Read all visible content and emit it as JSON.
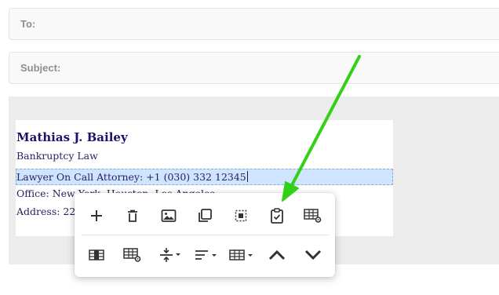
{
  "form": {
    "to_label": "To:",
    "subject_label": "Subject:"
  },
  "signature": {
    "name": "Mathias J. Bailey",
    "title": "Bankruptcy Law",
    "phone_line": "Lawyer On Call Attorney: +1 (030) 332 12345",
    "office_line": "Office: New York, Houston, Los Angeles",
    "address_line": "Address: 22"
  },
  "toolbar": {
    "row1": [
      "add-icon",
      "delete-icon",
      "image-icon",
      "duplicate-icon",
      "select-all-icon",
      "paste-icon",
      "table-settings-icon"
    ],
    "row2": [
      "columns-icon",
      "cell-settings-icon",
      "vertical-spacing-icon",
      "align-icon",
      "table-layout-icon",
      "move-up-icon",
      "move-down-icon"
    ]
  },
  "colors": {
    "arrow": "#33d017",
    "selection": "#cfe4ff",
    "name_text": "#1f1166"
  }
}
